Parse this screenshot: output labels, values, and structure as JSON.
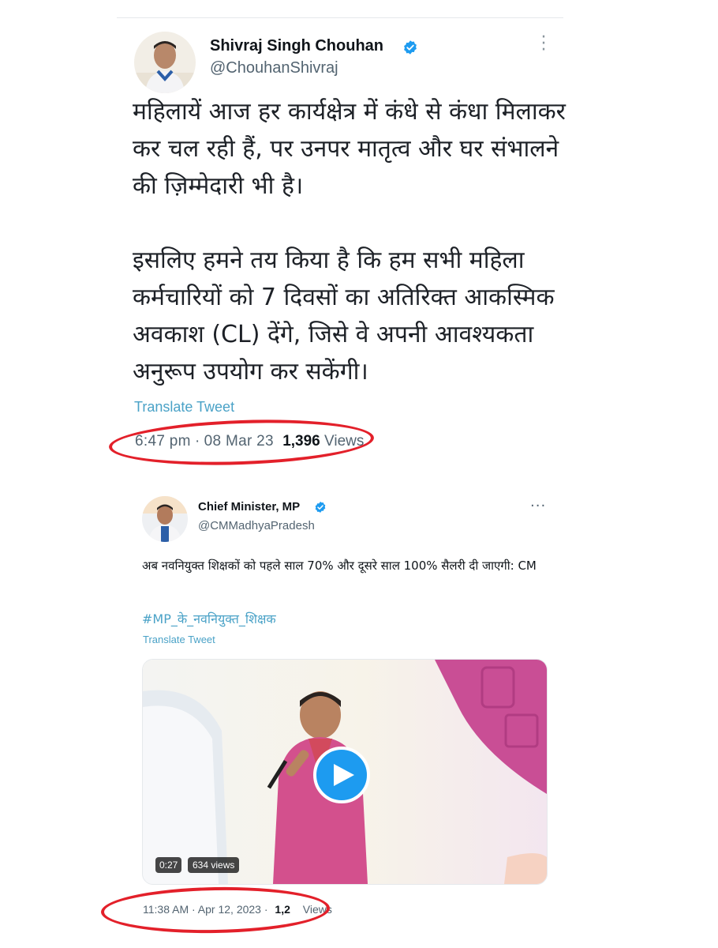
{
  "tweets": [
    {
      "author_name": "Shivraj Singh Chouhan",
      "handle": "@ChouhanShivraj",
      "verified": true,
      "text_paragraph_1": "महिलायें आज हर कार्यक्षेत्र में कंधे से कंधा मिलाकर कर चल रही हैं, पर उनपर मातृत्व और घर संभालने की ज़िम्मेदारी भी है।",
      "text_paragraph_2": "इसलिए हमने तय किया है कि हम सभी महिला कर्मचारियों को 7 दिवसों का अतिरिक्त आकस्मिक अवकाश (CL) देंगे, जिसे वे अपनी आवश्यकता अनुरूप उपयोग कर सकेंगी।",
      "translate_label": "Translate Tweet",
      "time": "6:47 pm",
      "date": "08 Mar 23",
      "views_count": "1,396",
      "views_label": "Views"
    },
    {
      "author_name": "Chief Minister, MP",
      "handle": "@CMMadhyaPradesh",
      "verified": true,
      "text": "अब नवनियुक्त शिक्षकों को पहले साल 70% और दूसरे साल 100% सैलरी दी जाएगी: CM",
      "hashtag": "#MP_के_नवनियुक्त_शिक्षक",
      "translate_label": "Translate Tweet",
      "video": {
        "duration": "0:27",
        "views": "634 views"
      },
      "time": "11:38 AM",
      "date": "Apr 12, 2023",
      "views_count": "1,2",
      "views_label": "Views"
    }
  ],
  "colors": {
    "accent": "#1d9bf0",
    "link": "#4aa2c7",
    "secondary_text": "#536471",
    "highlight_ring": "#e3202a"
  }
}
